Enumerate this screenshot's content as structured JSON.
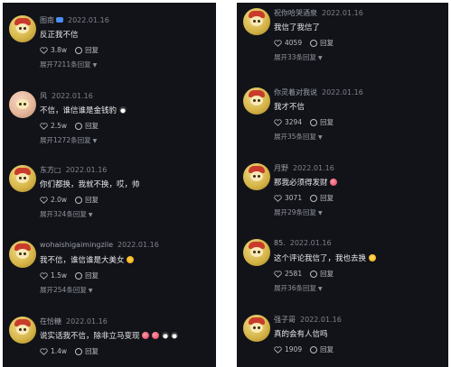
{
  "left_panel": {
    "comments": [
      {
        "username": "图南",
        "date": "2022.01.16",
        "text": "反正我不信",
        "likes": "3.8w",
        "reply_label": "回复",
        "expand": "展开7211条回复",
        "has_badge": true
      },
      {
        "username": "风",
        "date": "2022.01.16",
        "text": "不信，谁信谁是金钱豹",
        "likes": "2.5w",
        "reply_label": "回复",
        "expand": "展开1272条回复"
      },
      {
        "username": "东方□",
        "date": "2022.01.16",
        "text": "你们都换，我就不换，哎，帅",
        "likes": "2.0w",
        "reply_label": "回复",
        "expand": "展开324条回复"
      },
      {
        "username": "wohaishigaimingzile",
        "date": "2022.01.16",
        "text": "我不信，谁信谁是大美女",
        "likes": "1.5w",
        "reply_label": "回复",
        "expand": "展开254条回复"
      },
      {
        "username": "在恰糖",
        "date": "2022.01.16",
        "text": "说实话我不信，除非立马变现",
        "likes": "1.4w",
        "reply_label": "回复"
      }
    ]
  },
  "right_panel": {
    "comments": [
      {
        "username": "祝你哈哭酒泉",
        "date": "2022.01.16",
        "text": "我信了我信了",
        "likes": "4059",
        "reply_label": "回复",
        "expand": "展开33条回复"
      },
      {
        "username": "你灵着对我说",
        "date": "2022.01.16",
        "text": "我才不信",
        "likes": "3294",
        "reply_label": "回复",
        "expand": "展开35条回复"
      },
      {
        "username": "月野",
        "date": "2022.01.16",
        "text": "那我必须得发财",
        "likes": "3071",
        "reply_label": "回复",
        "expand": "展开29条回复"
      },
      {
        "username": "85.",
        "date": "2022.01.16",
        "text": "这个评论我信了，我也去换",
        "likes": "2581",
        "reply_label": "回复",
        "expand": "展开36条回复"
      },
      {
        "username": "强子哥",
        "date": "2022.01.16",
        "text": "真的会有人信吗",
        "likes": "1909",
        "reply_label": "回复"
      }
    ]
  },
  "icons": {
    "like": "heart-outline-icon",
    "reply": "speech-bubble-icon",
    "expand": "chevron-down-icon",
    "verified": "blue-badge-icon"
  },
  "colors": {
    "background": "#121319",
    "text_primary": "#e9e9ec",
    "text_secondary": "#9a9fa8",
    "divider": "#ffffff"
  }
}
